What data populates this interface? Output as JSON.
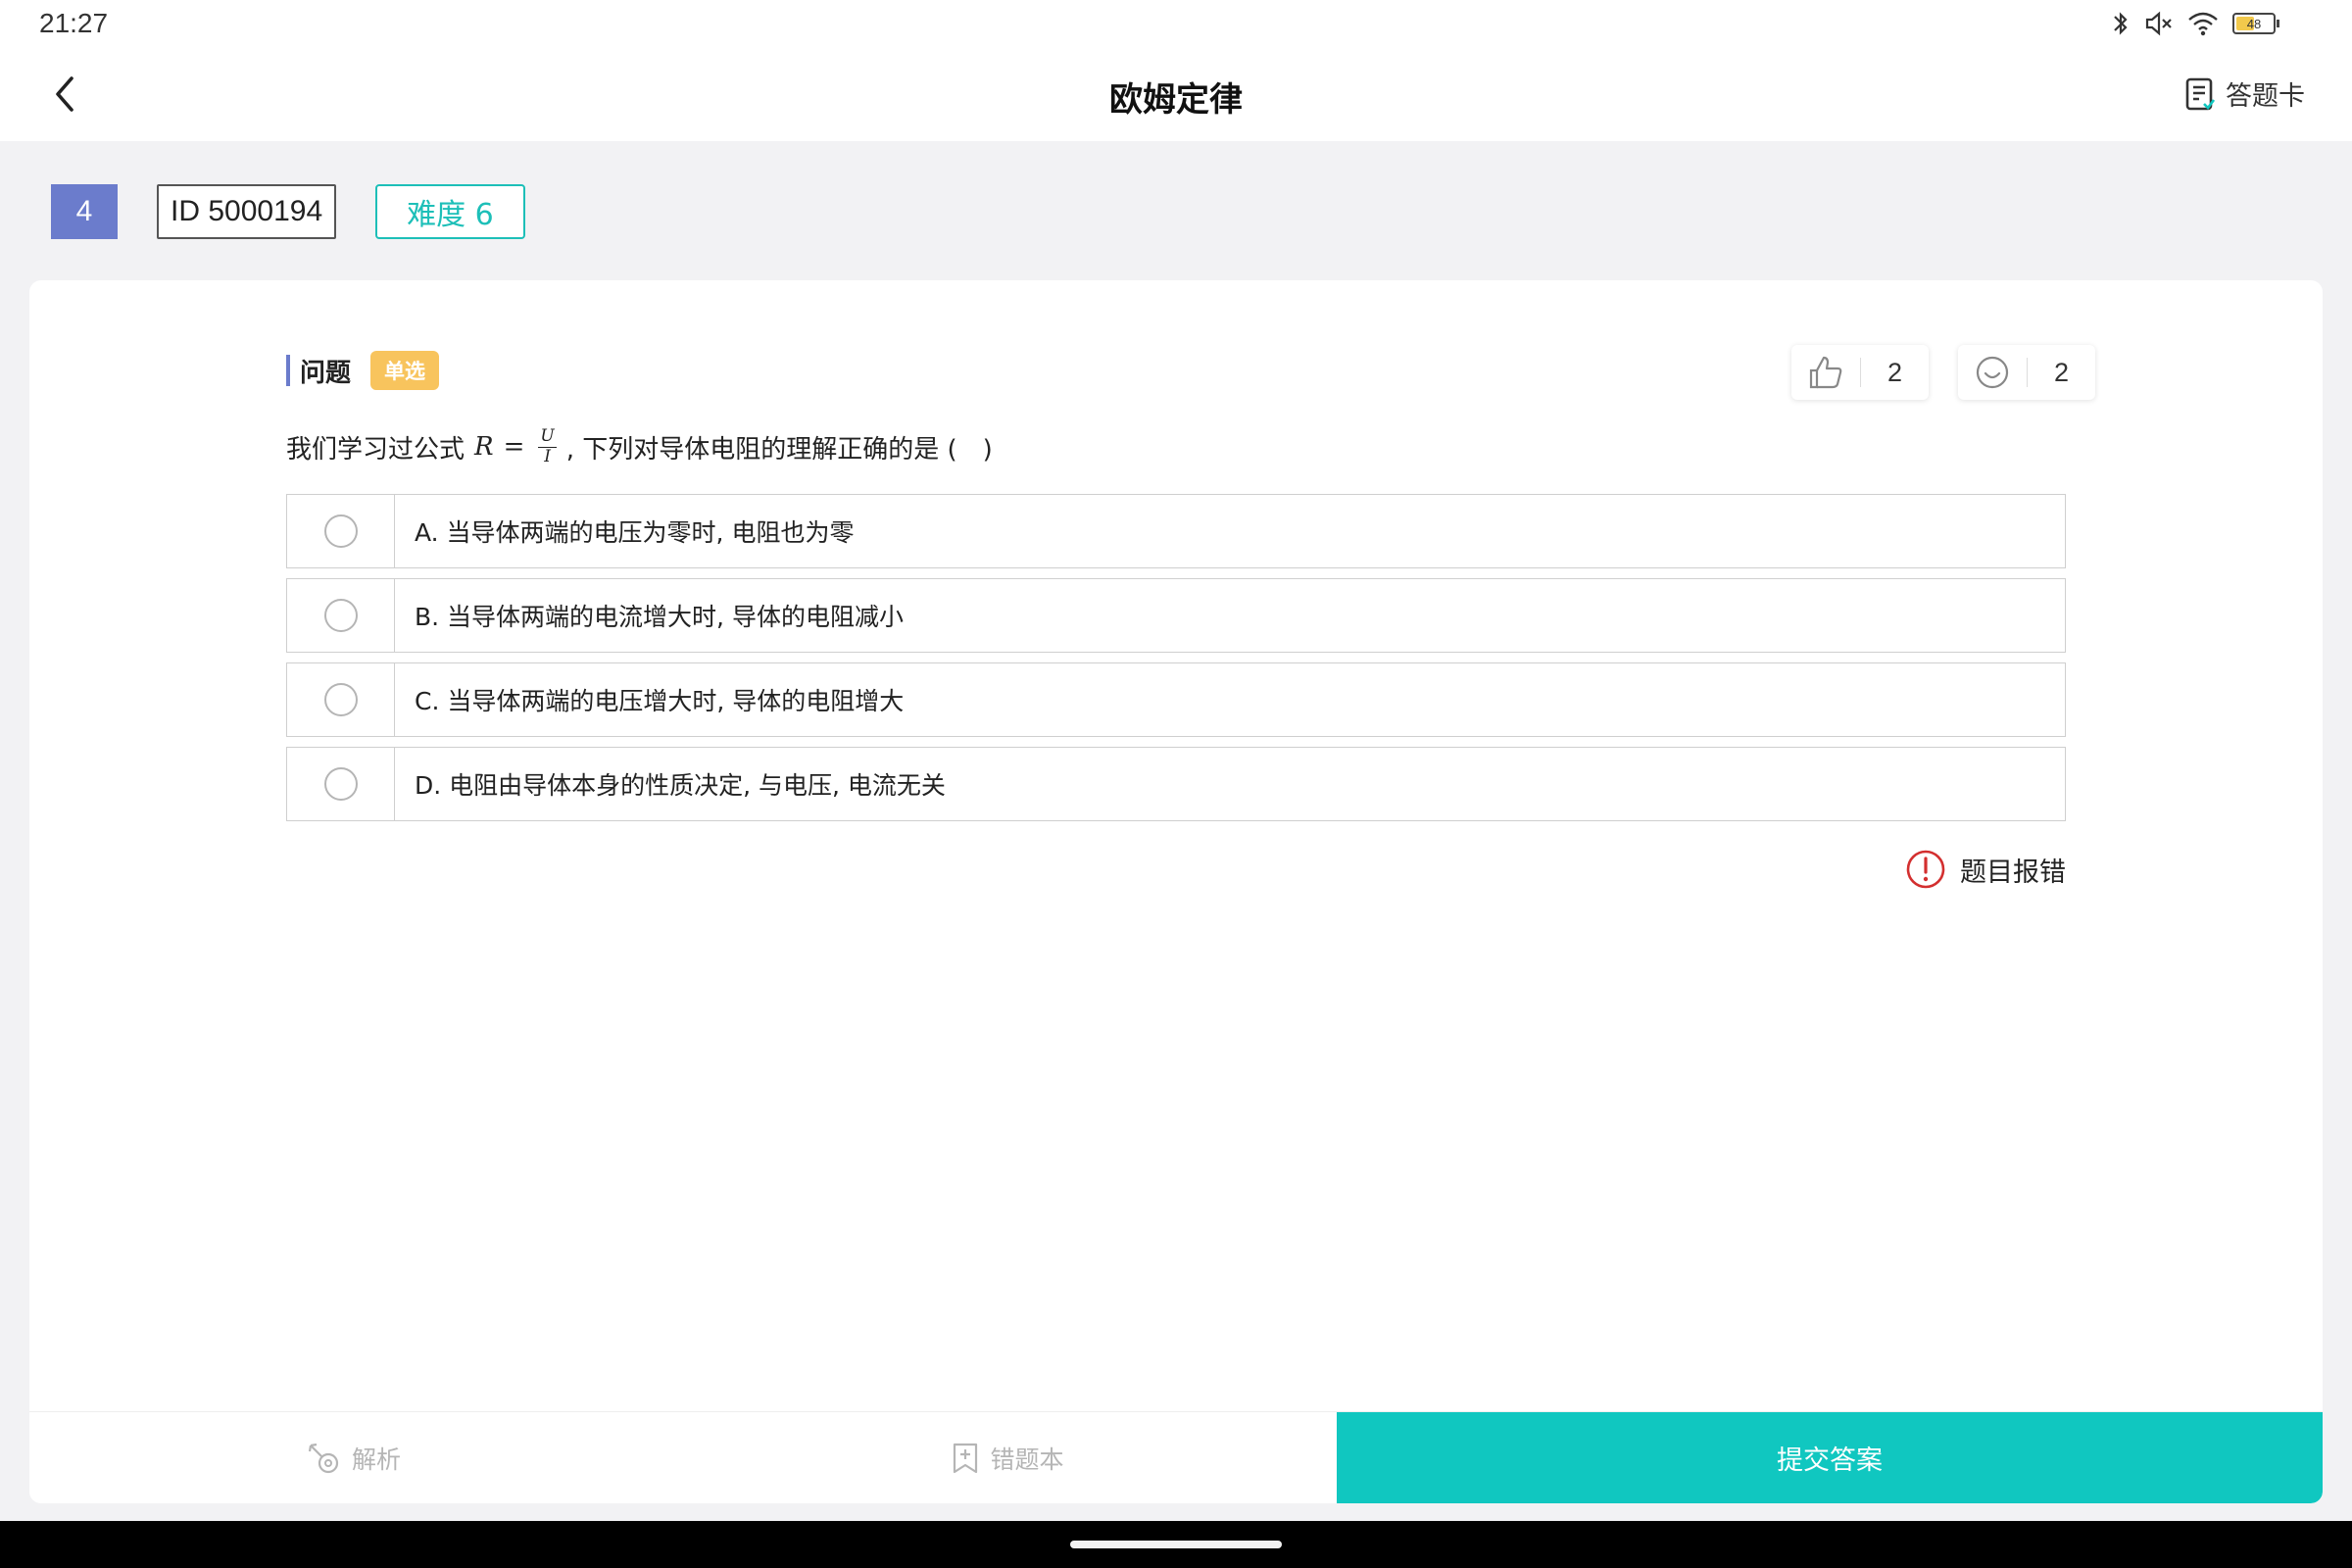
{
  "status_bar": {
    "time": "21:27",
    "battery": "48"
  },
  "header": {
    "title": "欧姆定律",
    "answer_card_label": "答题卡"
  },
  "chips": {
    "number": "4",
    "id": "ID 5000194",
    "difficulty": "难度 6"
  },
  "question": {
    "section_title": "问题",
    "type_badge": "单选",
    "likes": "2",
    "reactions": "2",
    "text_before": "我们学习过公式",
    "formula": {
      "lhs": "R",
      "eq": "=",
      "numerator": "U",
      "denominator": "I"
    },
    "text_after": ", 下列对导体电阻的理解正确的是 (　)",
    "options": [
      {
        "label": "A. 当导体两端的电压为零时, 电阻也为零"
      },
      {
        "label": "B. 当导体两端的电流增大时, 导体的电阻减小"
      },
      {
        "label": "C. 当导体两端的电压增大时, 导体的电阻增大"
      },
      {
        "label": "D. 电阻由导体本身的性质决定, 与电压, 电流无关"
      }
    ],
    "report_label": "题目报错"
  },
  "bottom": {
    "explain_label": "解析",
    "wrongbook_label": "错题本",
    "submit_label": "提交答案"
  },
  "colors": {
    "accent": "#10c7c0",
    "chip_number_bg": "#6b7ccc",
    "badge": "#f8c45d",
    "report": "#d32f2f"
  },
  "icons": [
    "back-arrow-icon",
    "answer-card-icon",
    "thumbs-up-icon",
    "smile-icon",
    "alert-icon",
    "explain-icon",
    "bookmark-add-icon",
    "bluetooth-icon",
    "mute-icon",
    "wifi-icon",
    "battery-icon"
  ]
}
